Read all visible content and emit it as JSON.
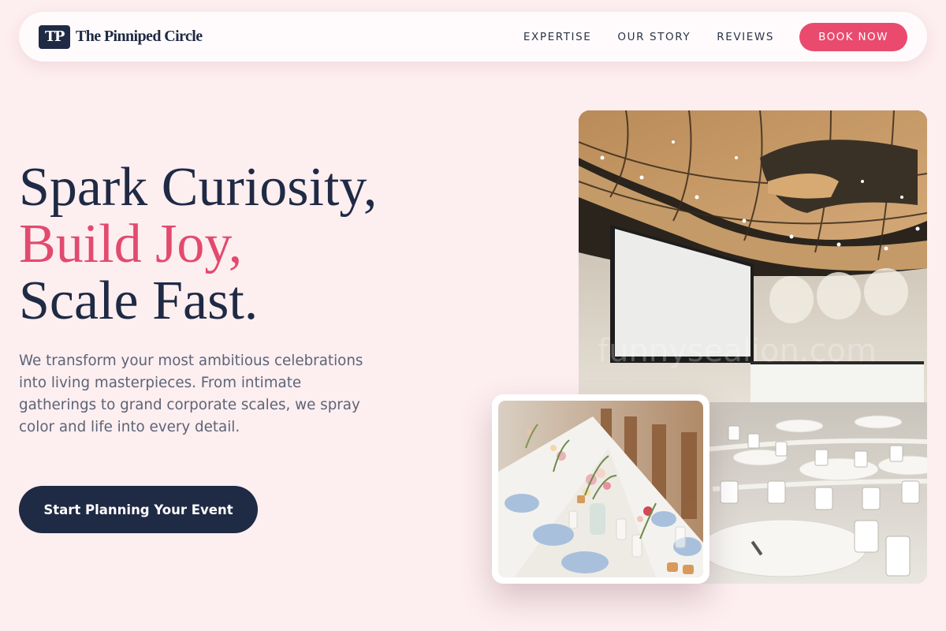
{
  "header": {
    "logo_mark": "TP",
    "logo_text": "The Pinniped Circle",
    "nav": [
      "EXPERTISE",
      "OUR STORY",
      "REVIEWS"
    ],
    "cta": "BOOK NOW"
  },
  "hero": {
    "title_line1": "Spark Curiosity,",
    "title_line2": "Build Joy,",
    "title_line3": "Scale Fast.",
    "subtitle": "We transform your most ambitious celebrations into living masterpieces. From intimate gatherings to grand corporate scales, we spray color and life into every detail.",
    "cta": "Start Planning Your Event"
  },
  "images": {
    "main_watermark": "funnysealion.com"
  },
  "colors": {
    "background": "#fdeef0",
    "navy": "#1f2a44",
    "accent_pink": "#e24a6e"
  }
}
